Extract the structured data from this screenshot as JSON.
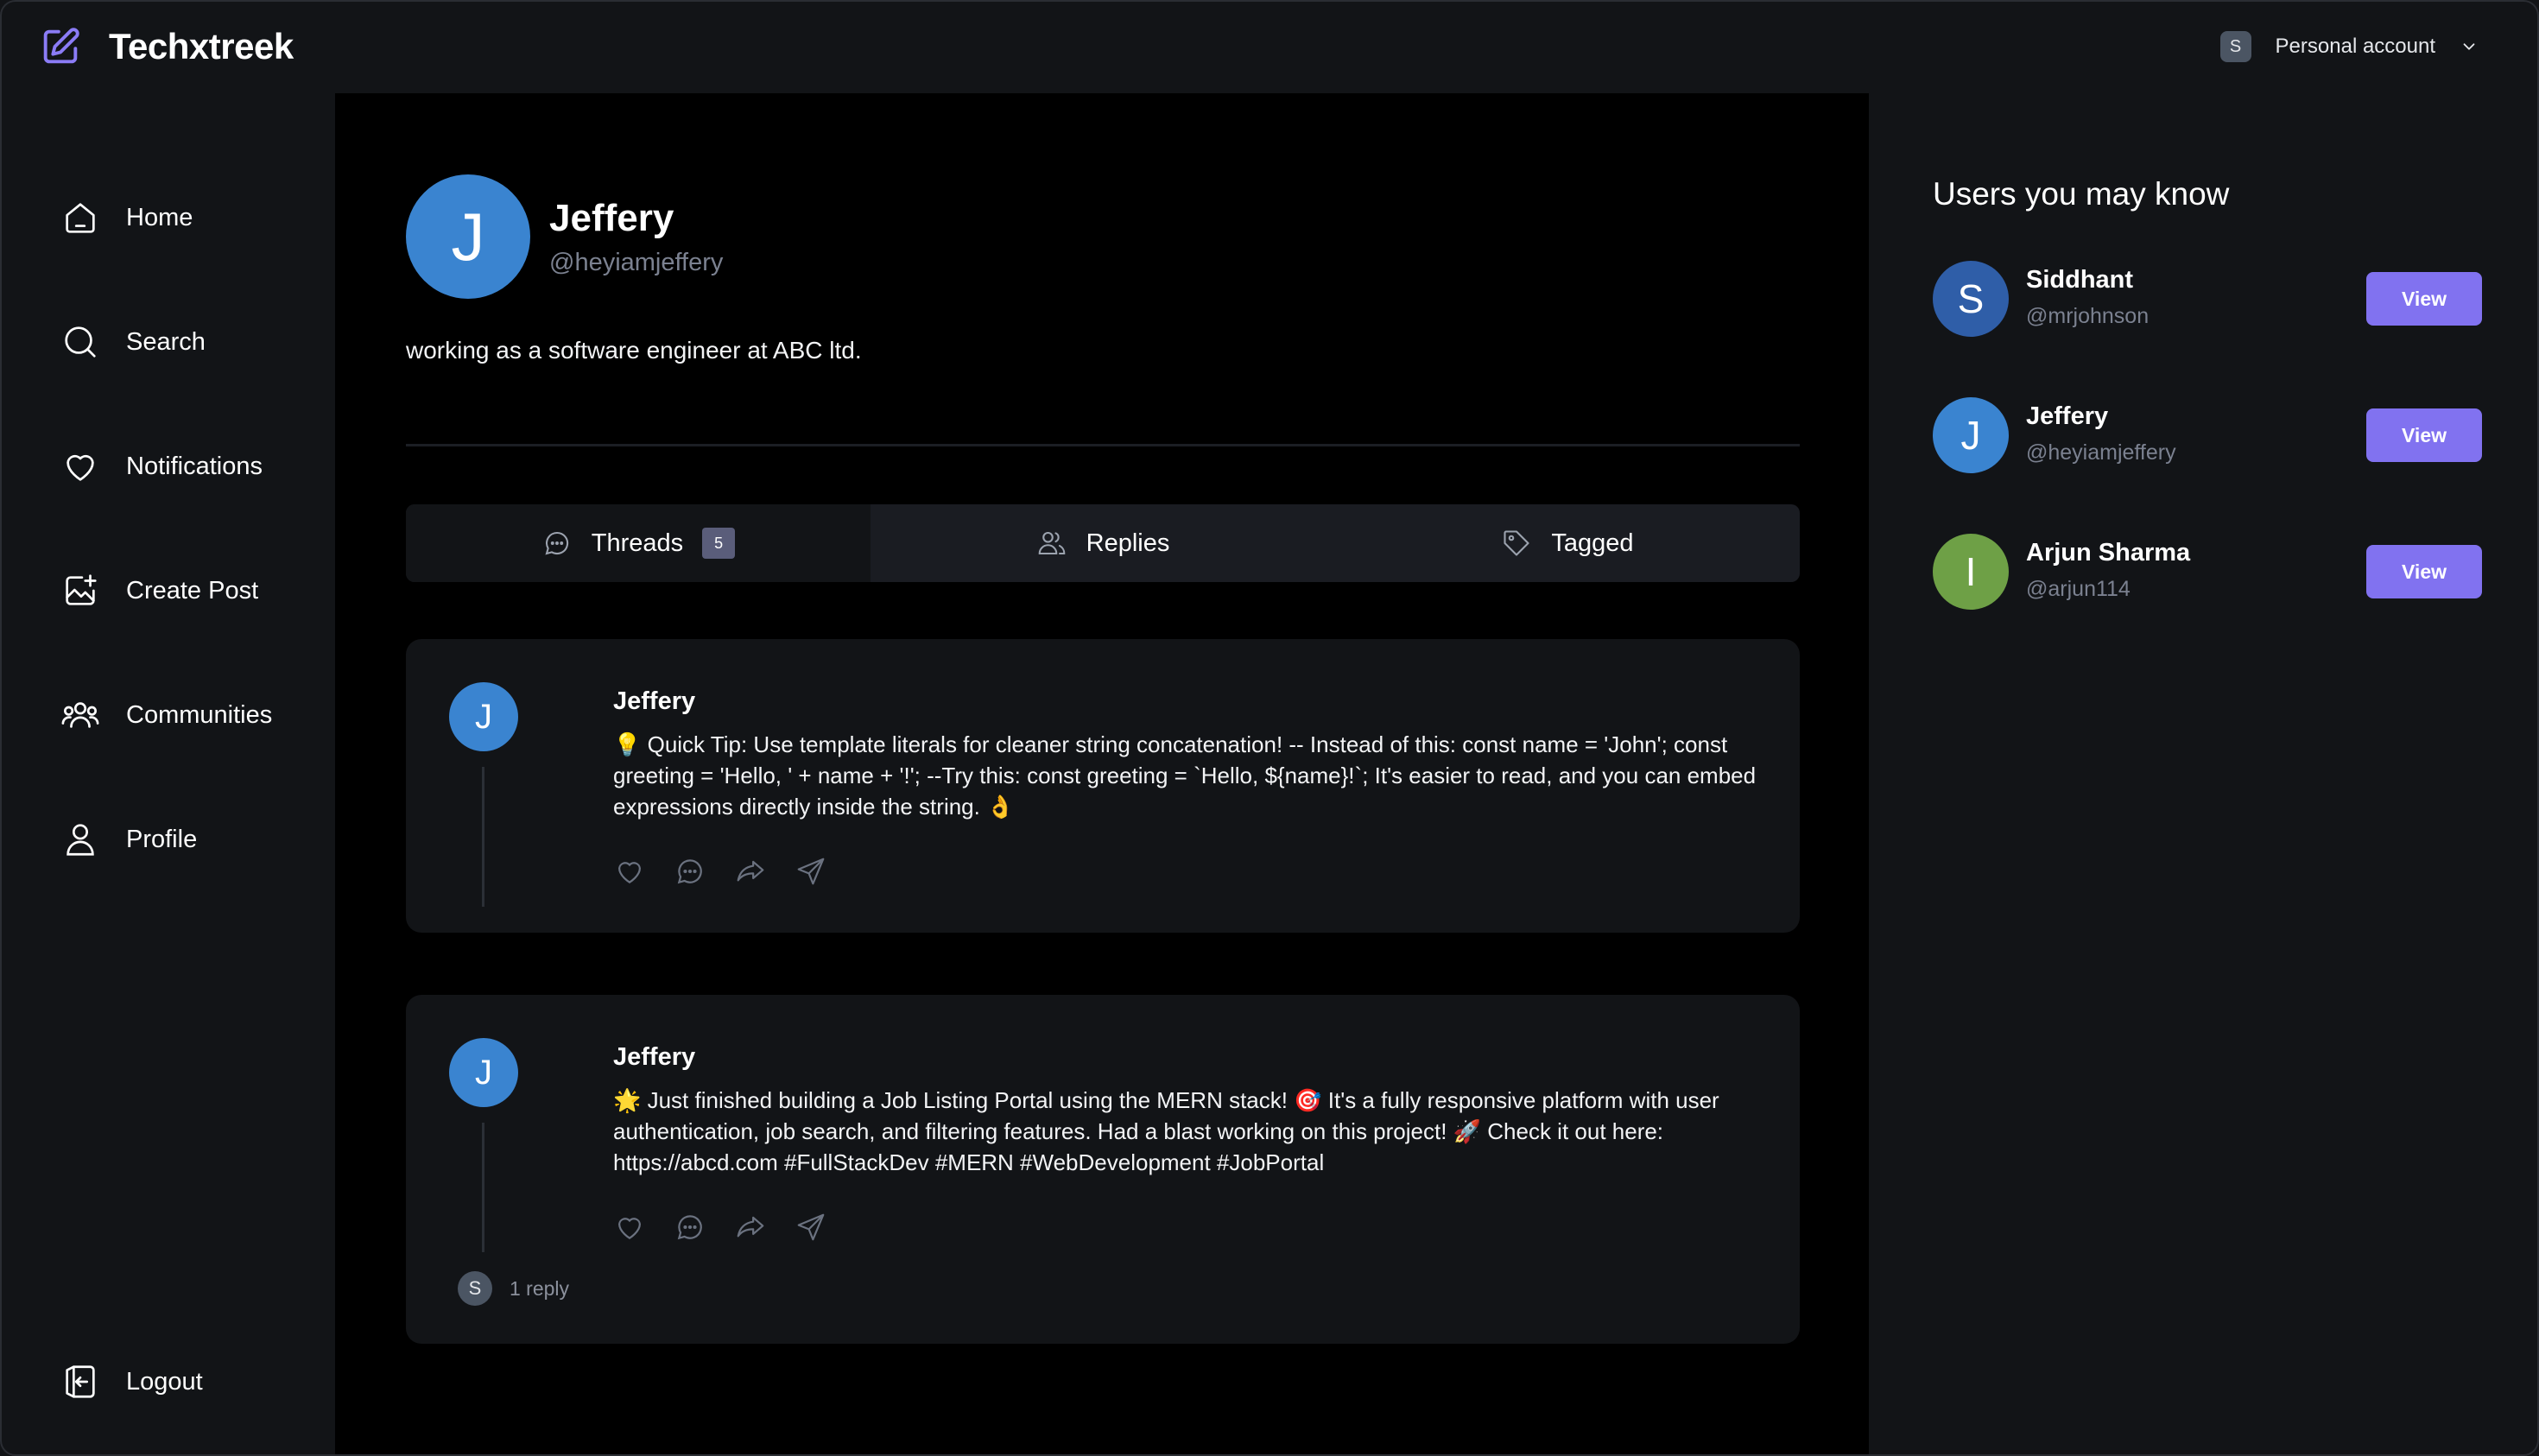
{
  "brand": {
    "name": "Techxtreek",
    "icon": "edit-square-icon",
    "accent": "#8b7cf6"
  },
  "account": {
    "avatar_letter": "S",
    "label": "Personal account",
    "icon": "chevron-down-icon"
  },
  "nav": {
    "items": [
      {
        "label": "Home",
        "icon": "home-icon"
      },
      {
        "label": "Search",
        "icon": "search-icon"
      },
      {
        "label": "Notifications",
        "icon": "heart-icon"
      },
      {
        "label": "Create Post",
        "icon": "image-plus-icon"
      },
      {
        "label": "Communities",
        "icon": "users-icon"
      },
      {
        "label": "Profile",
        "icon": "user-icon"
      }
    ],
    "logout": {
      "label": "Logout",
      "icon": "logout-icon"
    }
  },
  "profile": {
    "avatar_letter": "J",
    "name": "Jeffery",
    "handle": "@heyiamjeffery",
    "bio": "working as a software engineer at ABC ltd."
  },
  "tabs": [
    {
      "label": "Threads",
      "icon": "chat-bubble-icon",
      "badge": "5",
      "active": true
    },
    {
      "label": "Replies",
      "icon": "users-icon",
      "active": false
    },
    {
      "label": "Tagged",
      "icon": "tag-icon",
      "active": false
    }
  ],
  "threads": [
    {
      "avatar_letter": "J",
      "author": "Jeffery",
      "text": "💡 Quick Tip: Use template literals for cleaner string concatenation! -- Instead of this: const name = 'John'; const greeting = 'Hello, ' + name + '!'; --Try this: const greeting = `Hello, ${name}!`; It's easier to read, and you can embed expressions directly inside the string. 👌"
    },
    {
      "avatar_letter": "J",
      "author": "Jeffery",
      "text": "🌟 Just finished building a Job Listing Portal using the MERN stack! 🎯 It's a fully responsive platform with user authentication, job search, and filtering features. Had a blast working on this project! 🚀 Check it out here: https://abcd.com #FullStackDev #MERN #WebDevelopment #JobPortal",
      "reply_avatar_letter": "S",
      "reply_count": "1 reply"
    }
  ],
  "suggestions": {
    "title": "Users you may know",
    "button_label": "View",
    "users": [
      {
        "letter": "S",
        "name": "Siddhant",
        "handle": "@mrjohnson",
        "color": "#2f5ea8"
      },
      {
        "letter": "J",
        "name": "Jeffery",
        "handle": "@heyiamjeffery",
        "color": "#3a84d0"
      },
      {
        "letter": "I",
        "name": "Arjun Sharma",
        "handle": "@arjun114",
        "color": "#6ea046"
      }
    ]
  },
  "colors": {
    "button": "#8172f0",
    "avatar_blue": "#3a84d0",
    "background": "#121417",
    "main": "#000000"
  }
}
